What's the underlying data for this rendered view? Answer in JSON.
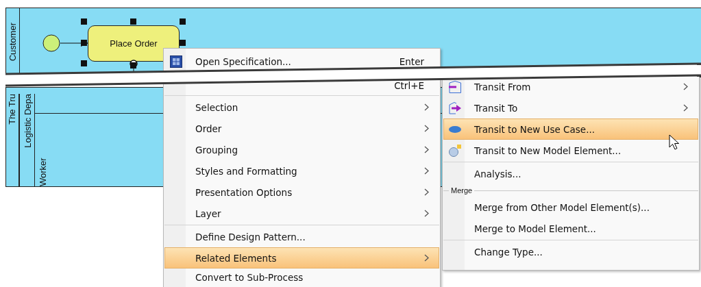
{
  "diagram": {
    "top_pool": {
      "lane": "Customer"
    },
    "task": {
      "label": "Place Order",
      "selected": true
    },
    "bottom_pool": {
      "name": "The Tru",
      "department": "Logistic Depa",
      "lane": "Worker"
    }
  },
  "context_menu": {
    "items": [
      {
        "kind": "item",
        "label": "Open Specification...",
        "shortcut": "Enter",
        "submenu": false,
        "selected": false
      },
      {
        "kind": "break"
      },
      {
        "kind": "item",
        "shortcut": "Ctrl+E",
        "selected": false
      },
      {
        "kind": "separator"
      },
      {
        "kind": "item",
        "label": "Selection",
        "submenu": true,
        "selected": false
      },
      {
        "kind": "item",
        "label": "Order",
        "submenu": true,
        "selected": false
      },
      {
        "kind": "item",
        "label": "Grouping",
        "submenu": true,
        "selected": false
      },
      {
        "kind": "item",
        "label": "Styles and Formatting",
        "submenu": true,
        "selected": false
      },
      {
        "kind": "item",
        "label": "Presentation Options",
        "submenu": true,
        "selected": false
      },
      {
        "kind": "item",
        "label": "Layer",
        "submenu": true,
        "selected": false
      },
      {
        "kind": "separator"
      },
      {
        "kind": "item",
        "label": "Define Design Pattern...",
        "submenu": false,
        "selected": false
      },
      {
        "kind": "item",
        "label": "Related Elements",
        "submenu": true,
        "selected": true
      },
      {
        "kind": "item",
        "label": "Convert to Sub-Process",
        "submenu": false,
        "selected": false
      }
    ]
  },
  "submenu": {
    "items": [
      {
        "kind": "item",
        "label": "Transit From",
        "submenu": true,
        "selected": false
      },
      {
        "kind": "item",
        "label": "Transit To",
        "submenu": true,
        "selected": false
      },
      {
        "kind": "item",
        "label": "Transit to New Use Case...",
        "submenu": false,
        "selected": true
      },
      {
        "kind": "item",
        "label": "Transit to New Model Element...",
        "submenu": false,
        "selected": false
      },
      {
        "kind": "separator"
      },
      {
        "kind": "item",
        "label": "Analysis...",
        "submenu": false,
        "selected": false
      },
      {
        "kind": "header",
        "label": "Merge"
      },
      {
        "kind": "item",
        "label": "Merge from Other Model Element(s)...",
        "submenu": false,
        "selected": false
      },
      {
        "kind": "item",
        "label": "Merge to Model Element...",
        "submenu": false,
        "selected": false
      },
      {
        "kind": "separator"
      },
      {
        "kind": "item",
        "label": "Change Type...",
        "submenu": false,
        "selected": false
      }
    ]
  }
}
